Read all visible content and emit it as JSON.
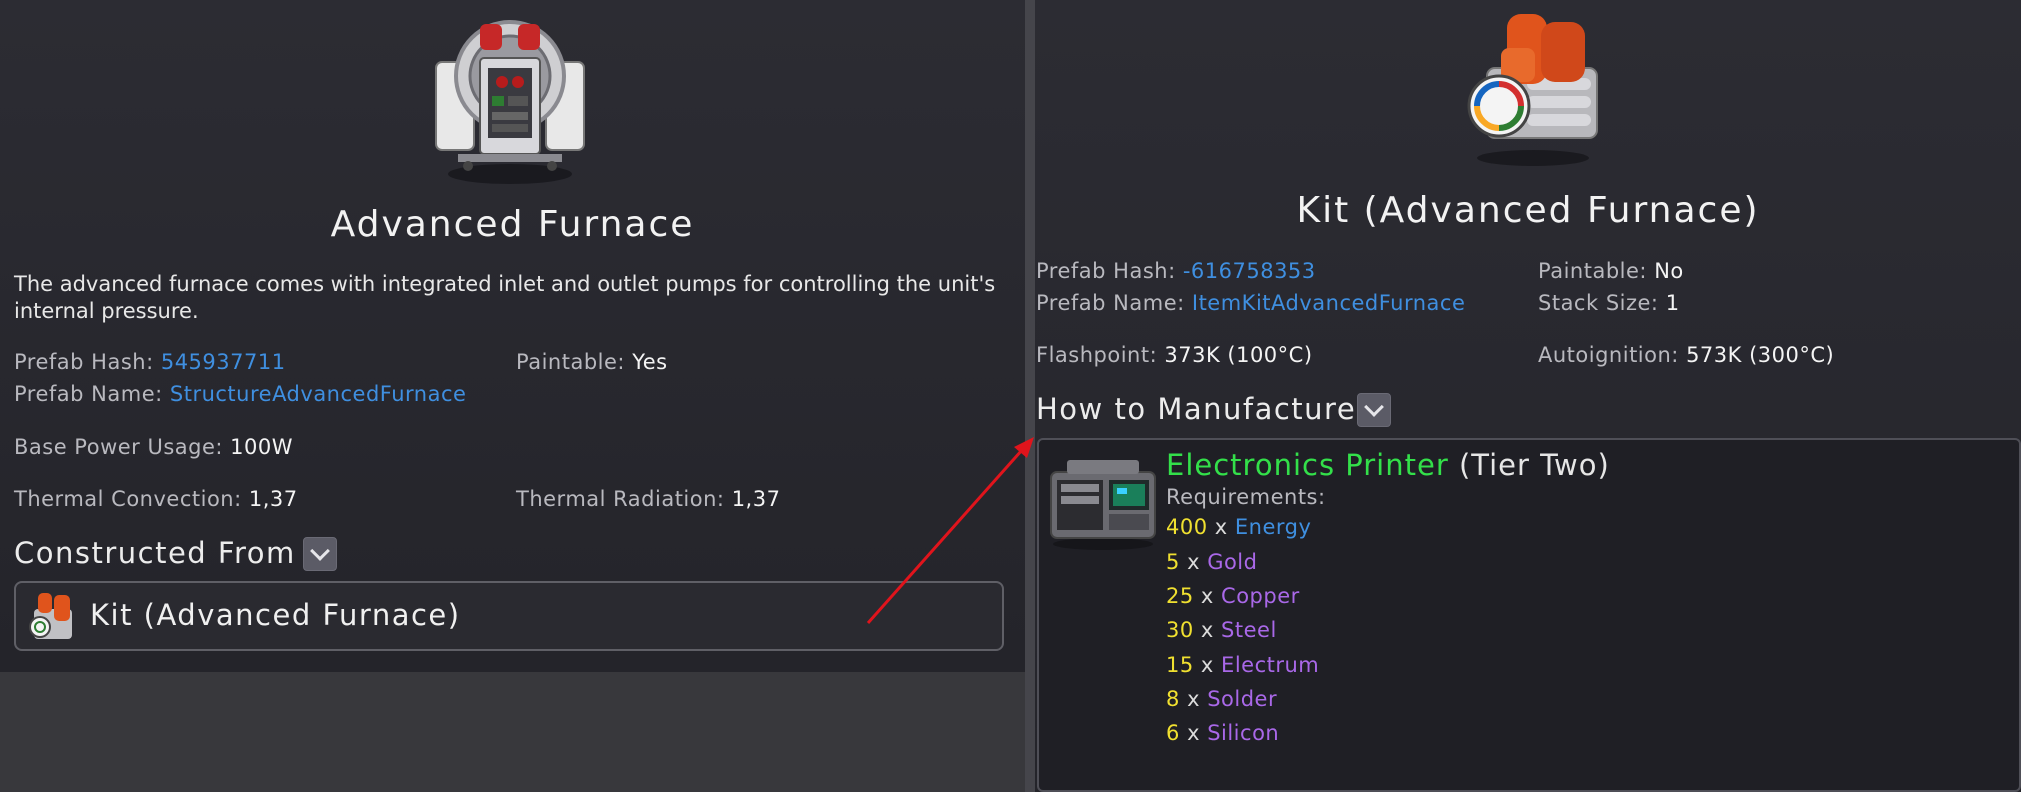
{
  "left": {
    "title": "Advanced Furnace",
    "description": "The advanced furnace comes with integrated inlet and outlet pumps for controlling the unit's internal pressure.",
    "prefab_hash_label": "Prefab Hash:",
    "prefab_hash_value": "545937711",
    "prefab_name_label": "Prefab Name:",
    "prefab_name_value": "StructureAdvancedFurnace",
    "paintable_label": "Paintable:",
    "paintable_value": "Yes",
    "base_power_label": "Base Power Usage:",
    "base_power_value": "100W",
    "thermal_convection_label": "Thermal Convection:",
    "thermal_convection_value": "1,37",
    "thermal_radiation_label": "Thermal Radiation:",
    "thermal_radiation_value": "1,37",
    "constructed_from_label": "Constructed From",
    "kit_label": "Kit (Advanced Furnace)"
  },
  "right": {
    "title": "Kit (Advanced Furnace)",
    "prefab_hash_label": "Prefab Hash:",
    "prefab_hash_value": "-616758353",
    "prefab_name_label": "Prefab Name:",
    "prefab_name_value": "ItemKitAdvancedFurnace",
    "paintable_label": "Paintable:",
    "paintable_value": "No",
    "stack_size_label": "Stack Size:",
    "stack_size_value": "1",
    "flashpoint_label": "Flashpoint:",
    "flashpoint_value": "373K (100°C)",
    "autoignition_label": "Autoignition:",
    "autoignition_value": "573K (300°C)",
    "how_to_manufacture_label": "How to Manufacture",
    "printer_name": "Electronics Printer",
    "printer_tier": "(Tier Two)",
    "requirements_label": "Requirements:",
    "multiply_symbol": "x",
    "requirements": [
      {
        "qty": "400",
        "item": "Energy"
      },
      {
        "qty": "5",
        "item": "Gold"
      },
      {
        "qty": "25",
        "item": "Copper"
      },
      {
        "qty": "30",
        "item": "Steel"
      },
      {
        "qty": "15",
        "item": "Electrum"
      },
      {
        "qty": "8",
        "item": "Solder"
      },
      {
        "qty": "6",
        "item": "Silicon"
      }
    ]
  },
  "colors": {
    "link": "#3f8fe0",
    "printer_green": "#33e04a",
    "quantity_yellow": "#f0e030",
    "material_purple": "#a968e8",
    "arrow_red": "#e0141c"
  },
  "icons": {
    "furnace": "advanced-furnace-icon",
    "kit": "kit-advanced-furnace-icon",
    "printer": "electronics-printer-icon",
    "dropdown": "chevron-down-icon",
    "annotation": "red-arrow-icon"
  }
}
